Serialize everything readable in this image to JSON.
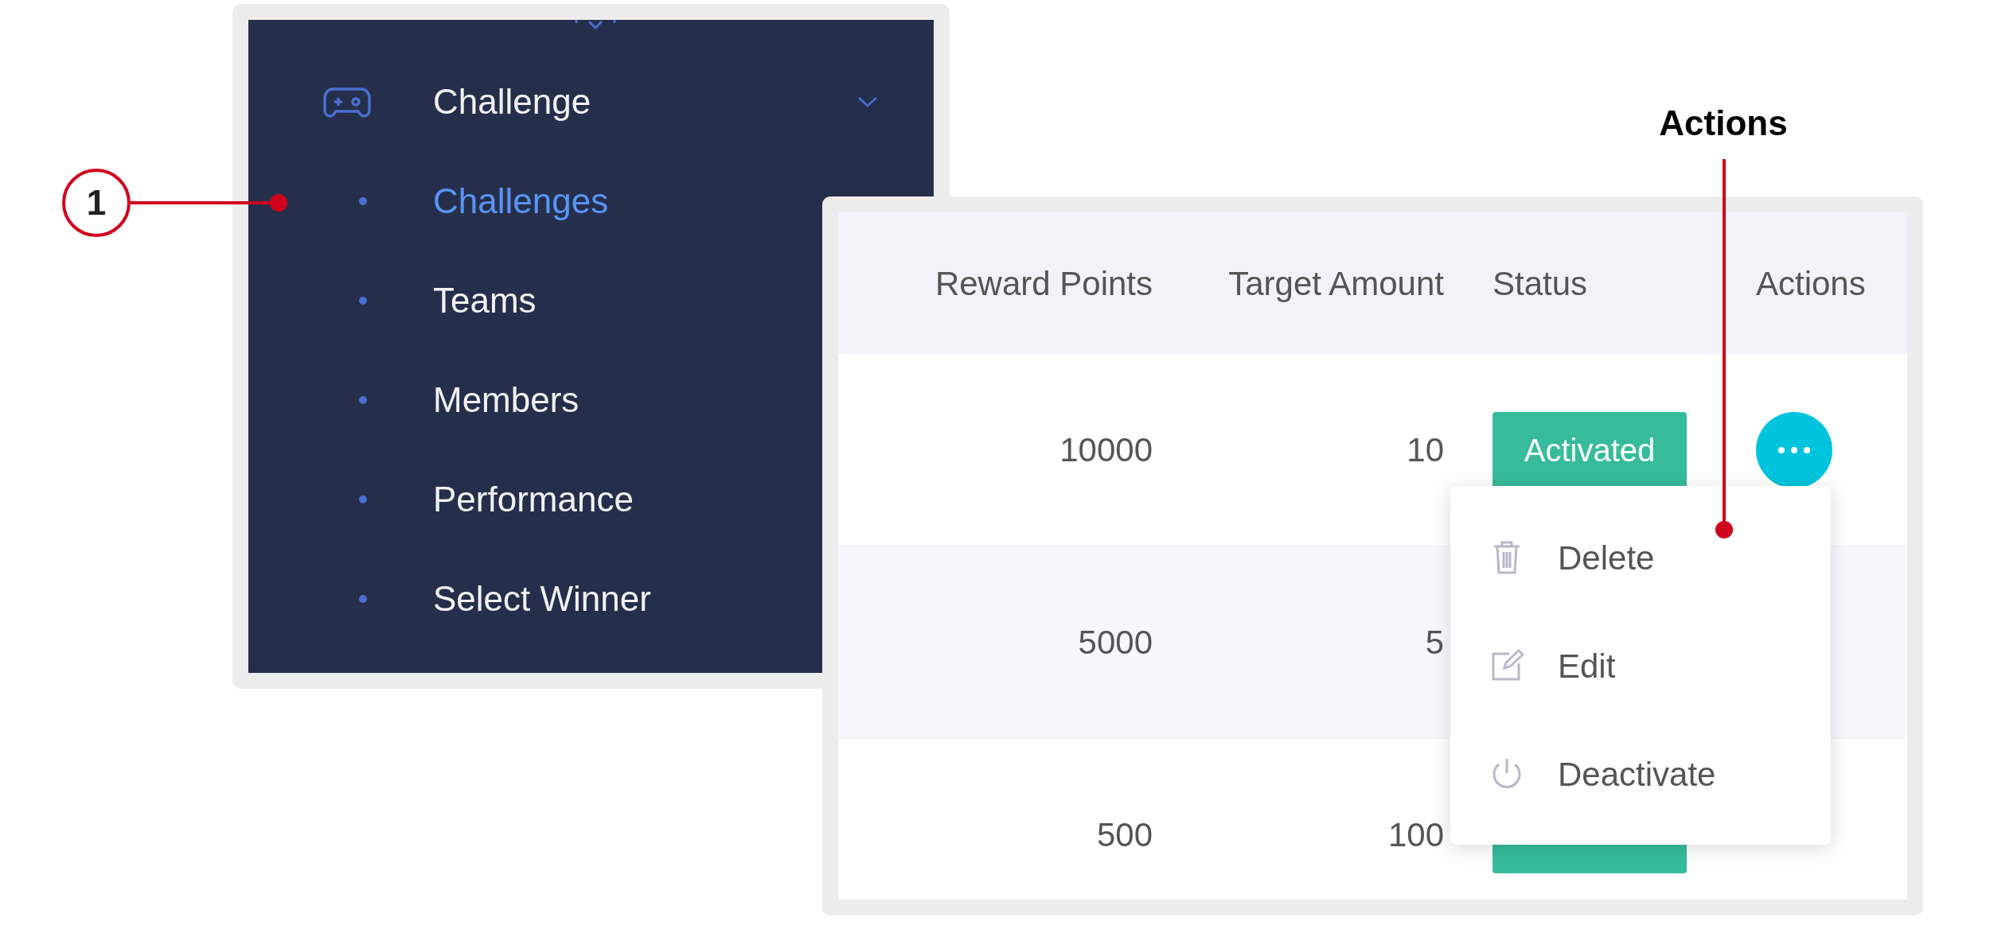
{
  "callout": {
    "number": "1"
  },
  "sidebar": {
    "group": {
      "label": "Challenge",
      "expanded": true
    },
    "items": [
      {
        "label": "Challenges",
        "selected": true
      },
      {
        "label": "Teams",
        "selected": false
      },
      {
        "label": "Members",
        "selected": false
      },
      {
        "label": "Performance",
        "selected": false
      },
      {
        "label": "Select Winner",
        "selected": false
      }
    ]
  },
  "table": {
    "columns": [
      "Reward Points",
      "Target Amount",
      "Status",
      "Actions"
    ],
    "rows": [
      {
        "reward_points": "10000",
        "target_amount": "10",
        "status": "Activated",
        "actions_button": true
      },
      {
        "reward_points": "5000",
        "target_amount": "5"
      },
      {
        "reward_points": "500",
        "target_amount": "100",
        "status_badge": true
      }
    ]
  },
  "actions_menu": {
    "items": [
      {
        "kind": "delete",
        "label": "Delete"
      },
      {
        "kind": "edit",
        "label": "Edit"
      },
      {
        "kind": "deactivate",
        "label": "Deactivate"
      }
    ]
  },
  "annotation": {
    "label": "Actions"
  }
}
